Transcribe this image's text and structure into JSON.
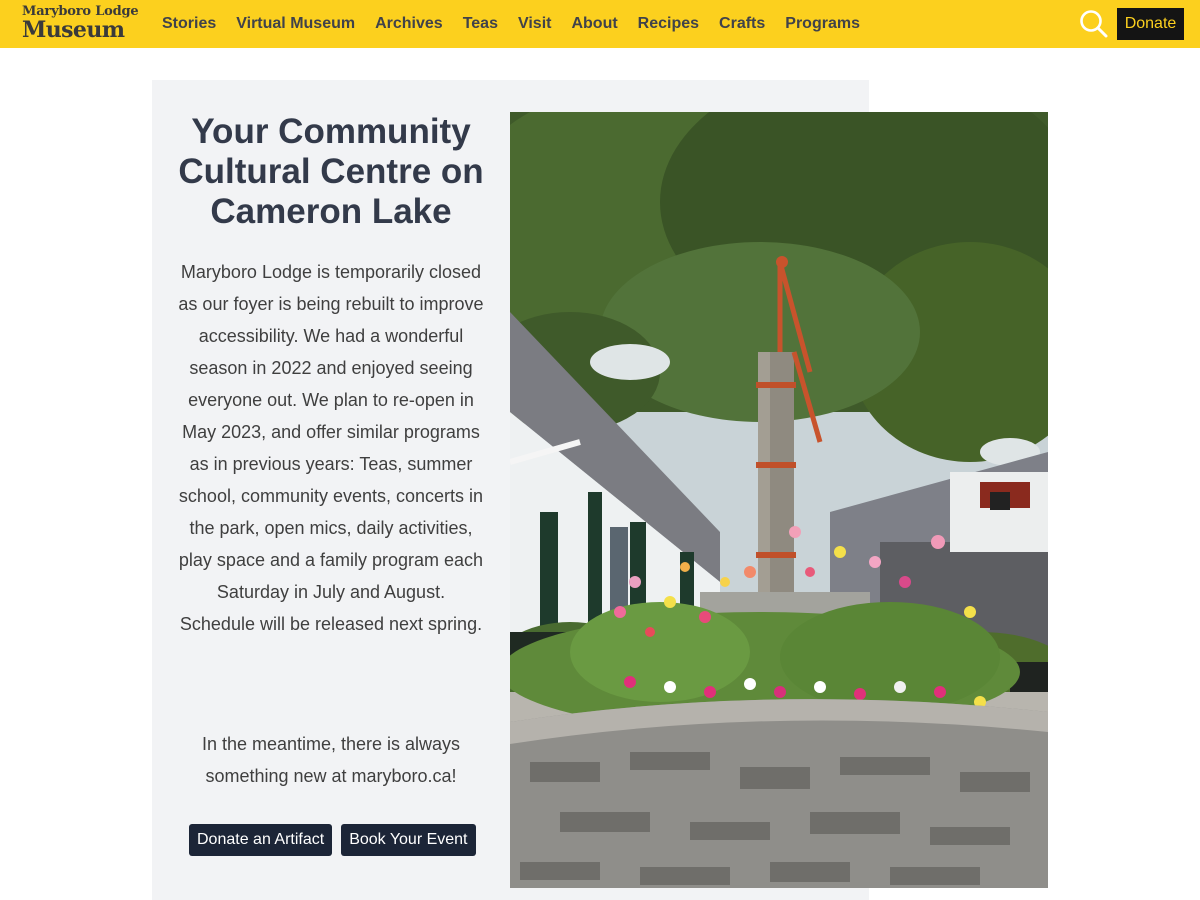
{
  "header": {
    "logo": {
      "top_line": "Maryboro Lodge",
      "main_line": "Museum"
    },
    "nav": [
      {
        "label": "Stories"
      },
      {
        "label": "Virtual Museum"
      },
      {
        "label": "Archives"
      },
      {
        "label": "Teas"
      },
      {
        "label": "Visit"
      },
      {
        "label": "About"
      },
      {
        "label": "Recipes"
      },
      {
        "label": "Crafts"
      },
      {
        "label": "Programs"
      }
    ],
    "search_icon": "search-icon",
    "donate_label": "Donate"
  },
  "hero": {
    "title": "Your Community Cultural Centre on Cameron Lake",
    "body": "Maryboro Lodge is temporarily closed as our foyer is being rebuilt to improve accessibility. We had a wonderful season in 2022 and enjoyed seeing everyone out. We plan to re-open in May 2023, and offer similar programs as in previous years: Teas, summer school, community events, concerts in the park, open mics, daily activities, play space and a family program each Saturday in July and August. Schedule will be released next spring.",
    "note": "In the meantime, there is always something new at maryboro.ca!",
    "buttons": [
      {
        "label": "Donate an Artifact"
      },
      {
        "label": "Book Your Event"
      }
    ]
  },
  "colors": {
    "header_bg": "#fcd01e",
    "donate_bg": "#141414",
    "panel_bg": "#f2f3f5",
    "button_bg": "#1c2537"
  }
}
